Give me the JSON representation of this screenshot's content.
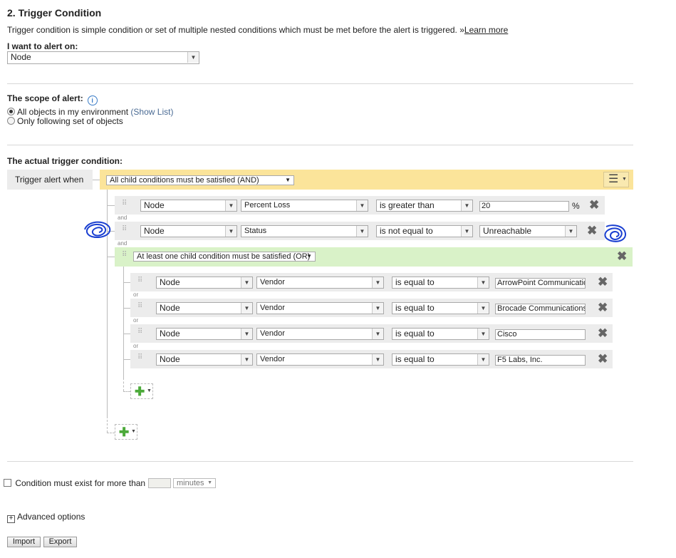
{
  "header": {
    "title": "2. Trigger Condition",
    "description": "Trigger condition is simple condition or set of multiple nested conditions which must be met before the alert is triggered.",
    "learn_more_prefix": "»",
    "learn_more": "Learn more"
  },
  "alert_on": {
    "label": "I want to alert on:",
    "value": "Node"
  },
  "scope": {
    "label": "The scope of alert:",
    "option_all": "All objects in my environment",
    "show_list": "(Show List)",
    "option_following": "Only following set of objects",
    "selected": "all"
  },
  "trigger": {
    "label": "The actual trigger condition:",
    "when_label": "Trigger alert when",
    "root_mode": "All child conditions must be satisfied (AND)",
    "and_label": "and",
    "or_label": "or",
    "conditions": [
      {
        "object": "Node",
        "field": "Percent Loss",
        "operator": "is greater than",
        "value": "20",
        "unit": "%"
      },
      {
        "object": "Node",
        "field": "Status",
        "operator": "is not equal to",
        "value": "Unreachable"
      }
    ],
    "group": {
      "mode": "At least one child condition must be satisfied (OR)",
      "conditions": [
        {
          "object": "Node",
          "field": "Vendor",
          "operator": "is equal to",
          "value": "ArrowPoint Communications"
        },
        {
          "object": "Node",
          "field": "Vendor",
          "operator": "is equal to",
          "value": "Brocade Communications"
        },
        {
          "object": "Node",
          "field": "Vendor",
          "operator": "is equal to",
          "value": "Cisco"
        },
        {
          "object": "Node",
          "field": "Vendor",
          "operator": "is equal to",
          "value": "F5 Labs, Inc."
        }
      ]
    }
  },
  "duration": {
    "label": "Condition must exist for more than",
    "value": "",
    "unit": "minutes"
  },
  "advanced": {
    "label": "Advanced options"
  },
  "buttons": {
    "import": "Import",
    "export": "Export"
  },
  "colors": {
    "and_bar": "#fbe49a",
    "or_bar": "#d9f2c8",
    "row_bg": "#ececec",
    "scribble": "#1a3fd1"
  }
}
